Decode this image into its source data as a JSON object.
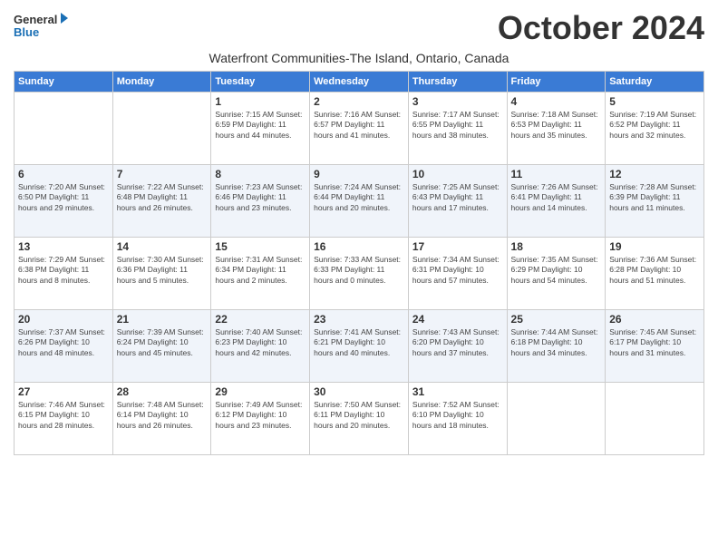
{
  "header": {
    "logo_general": "General",
    "logo_blue": "Blue",
    "month_title": "October 2024",
    "subtitle": "Waterfront Communities-The Island, Ontario, Canada"
  },
  "days_of_week": [
    "Sunday",
    "Monday",
    "Tuesday",
    "Wednesday",
    "Thursday",
    "Friday",
    "Saturday"
  ],
  "weeks": [
    [
      {
        "day": "",
        "info": ""
      },
      {
        "day": "",
        "info": ""
      },
      {
        "day": "1",
        "info": "Sunrise: 7:15 AM\nSunset: 6:59 PM\nDaylight: 11 hours and 44 minutes."
      },
      {
        "day": "2",
        "info": "Sunrise: 7:16 AM\nSunset: 6:57 PM\nDaylight: 11 hours and 41 minutes."
      },
      {
        "day": "3",
        "info": "Sunrise: 7:17 AM\nSunset: 6:55 PM\nDaylight: 11 hours and 38 minutes."
      },
      {
        "day": "4",
        "info": "Sunrise: 7:18 AM\nSunset: 6:53 PM\nDaylight: 11 hours and 35 minutes."
      },
      {
        "day": "5",
        "info": "Sunrise: 7:19 AM\nSunset: 6:52 PM\nDaylight: 11 hours and 32 minutes."
      }
    ],
    [
      {
        "day": "6",
        "info": "Sunrise: 7:20 AM\nSunset: 6:50 PM\nDaylight: 11 hours and 29 minutes."
      },
      {
        "day": "7",
        "info": "Sunrise: 7:22 AM\nSunset: 6:48 PM\nDaylight: 11 hours and 26 minutes."
      },
      {
        "day": "8",
        "info": "Sunrise: 7:23 AM\nSunset: 6:46 PM\nDaylight: 11 hours and 23 minutes."
      },
      {
        "day": "9",
        "info": "Sunrise: 7:24 AM\nSunset: 6:44 PM\nDaylight: 11 hours and 20 minutes."
      },
      {
        "day": "10",
        "info": "Sunrise: 7:25 AM\nSunset: 6:43 PM\nDaylight: 11 hours and 17 minutes."
      },
      {
        "day": "11",
        "info": "Sunrise: 7:26 AM\nSunset: 6:41 PM\nDaylight: 11 hours and 14 minutes."
      },
      {
        "day": "12",
        "info": "Sunrise: 7:28 AM\nSunset: 6:39 PM\nDaylight: 11 hours and 11 minutes."
      }
    ],
    [
      {
        "day": "13",
        "info": "Sunrise: 7:29 AM\nSunset: 6:38 PM\nDaylight: 11 hours and 8 minutes."
      },
      {
        "day": "14",
        "info": "Sunrise: 7:30 AM\nSunset: 6:36 PM\nDaylight: 11 hours and 5 minutes."
      },
      {
        "day": "15",
        "info": "Sunrise: 7:31 AM\nSunset: 6:34 PM\nDaylight: 11 hours and 2 minutes."
      },
      {
        "day": "16",
        "info": "Sunrise: 7:33 AM\nSunset: 6:33 PM\nDaylight: 11 hours and 0 minutes."
      },
      {
        "day": "17",
        "info": "Sunrise: 7:34 AM\nSunset: 6:31 PM\nDaylight: 10 hours and 57 minutes."
      },
      {
        "day": "18",
        "info": "Sunrise: 7:35 AM\nSunset: 6:29 PM\nDaylight: 10 hours and 54 minutes."
      },
      {
        "day": "19",
        "info": "Sunrise: 7:36 AM\nSunset: 6:28 PM\nDaylight: 10 hours and 51 minutes."
      }
    ],
    [
      {
        "day": "20",
        "info": "Sunrise: 7:37 AM\nSunset: 6:26 PM\nDaylight: 10 hours and 48 minutes."
      },
      {
        "day": "21",
        "info": "Sunrise: 7:39 AM\nSunset: 6:24 PM\nDaylight: 10 hours and 45 minutes."
      },
      {
        "day": "22",
        "info": "Sunrise: 7:40 AM\nSunset: 6:23 PM\nDaylight: 10 hours and 42 minutes."
      },
      {
        "day": "23",
        "info": "Sunrise: 7:41 AM\nSunset: 6:21 PM\nDaylight: 10 hours and 40 minutes."
      },
      {
        "day": "24",
        "info": "Sunrise: 7:43 AM\nSunset: 6:20 PM\nDaylight: 10 hours and 37 minutes."
      },
      {
        "day": "25",
        "info": "Sunrise: 7:44 AM\nSunset: 6:18 PM\nDaylight: 10 hours and 34 minutes."
      },
      {
        "day": "26",
        "info": "Sunrise: 7:45 AM\nSunset: 6:17 PM\nDaylight: 10 hours and 31 minutes."
      }
    ],
    [
      {
        "day": "27",
        "info": "Sunrise: 7:46 AM\nSunset: 6:15 PM\nDaylight: 10 hours and 28 minutes."
      },
      {
        "day": "28",
        "info": "Sunrise: 7:48 AM\nSunset: 6:14 PM\nDaylight: 10 hours and 26 minutes."
      },
      {
        "day": "29",
        "info": "Sunrise: 7:49 AM\nSunset: 6:12 PM\nDaylight: 10 hours and 23 minutes."
      },
      {
        "day": "30",
        "info": "Sunrise: 7:50 AM\nSunset: 6:11 PM\nDaylight: 10 hours and 20 minutes."
      },
      {
        "day": "31",
        "info": "Sunrise: 7:52 AM\nSunset: 6:10 PM\nDaylight: 10 hours and 18 minutes."
      },
      {
        "day": "",
        "info": ""
      },
      {
        "day": "",
        "info": ""
      }
    ]
  ]
}
